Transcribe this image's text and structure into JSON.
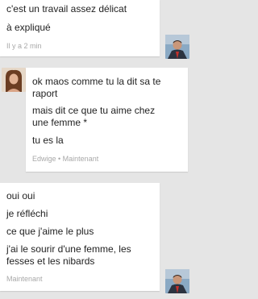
{
  "thread": {
    "block_1": {
      "lines": [
        "c'est un travail assez délicat",
        "à expliqué"
      ],
      "meta": "Il y a 2 min"
    },
    "block_2": {
      "lines": [
        "ok maos comme tu la dit sa te",
        "raport",
        "mais dit ce que tu aime chez",
        "une femme *",
        "tu es la"
      ],
      "meta": "Edwige • Maintenant"
    },
    "block_3": {
      "lines": [
        "oui oui",
        "je réfléchi",
        "ce que j'aime le plus",
        "j'ai le sourir d'une femme, les",
        "fesses et les nibards"
      ],
      "meta": "Maintenant"
    }
  },
  "avatars": {
    "self": "man-in-suit-avatar",
    "contact": "woman-portrait-avatar"
  },
  "colors": {
    "background": "#e5e5e5",
    "bubble": "#ffffff",
    "text": "#222222",
    "meta": "#a8a8a8"
  }
}
